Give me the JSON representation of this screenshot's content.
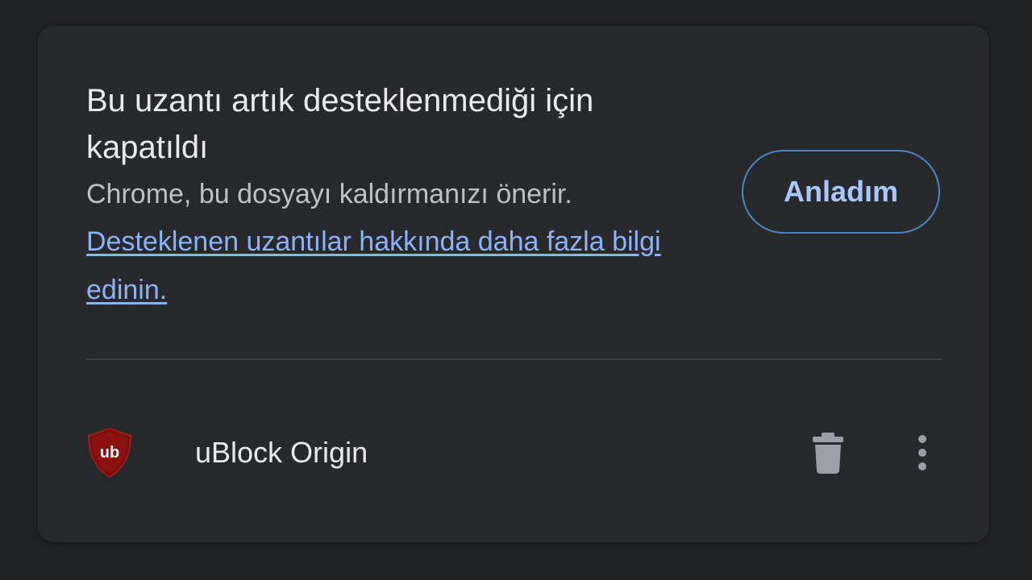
{
  "notice": {
    "title": "Bu uzantı artık desteklenmediği için kapatıldı",
    "subtitle": "Chrome, bu dosyayı kaldırmanızı önerir.",
    "link_text": "Desteklenen uzantılar hakkında daha fazla bilgi edinin.",
    "ack_button": "Anladım"
  },
  "extension": {
    "name": "uBlock Origin",
    "icon_name": "ublock-origin-shield-icon",
    "icon_glyph": "ub",
    "icon_color": "#800000"
  },
  "actions": {
    "remove_icon": "trash-icon",
    "more_icon": "more-vert-icon"
  },
  "colors": {
    "background": "#202124",
    "card": "#28292c",
    "link": "#8ab4f8",
    "button_border": "#4a84c4",
    "button_text": "#a8c7fa"
  }
}
